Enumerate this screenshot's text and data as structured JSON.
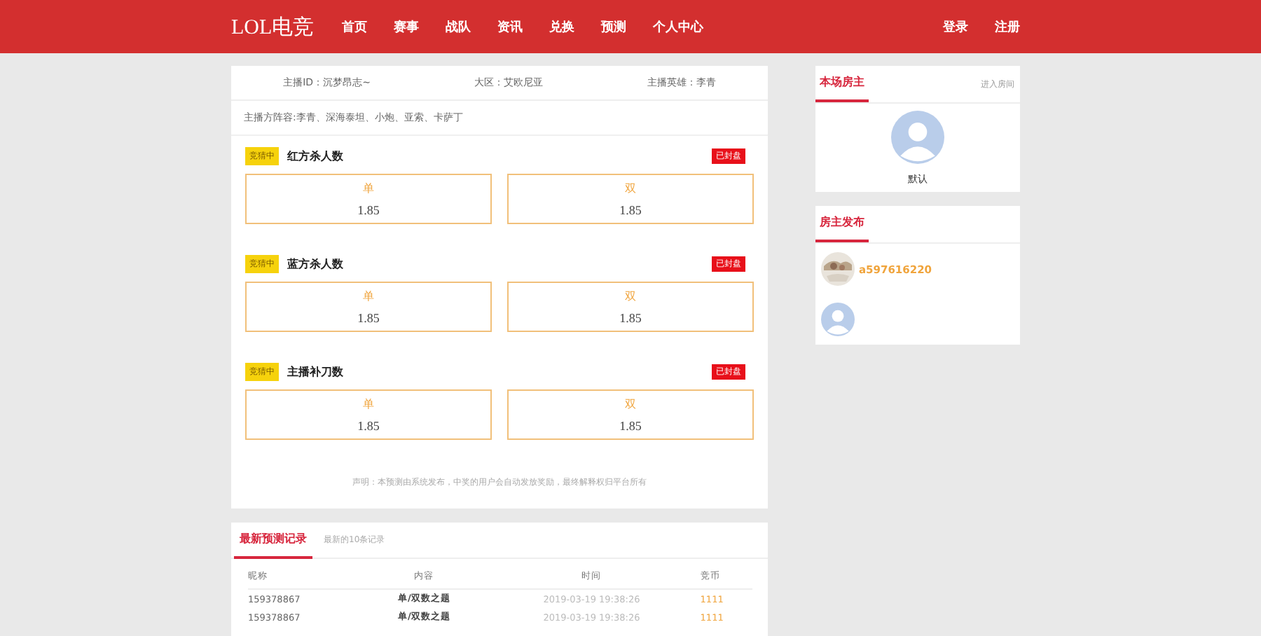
{
  "header": {
    "logo": "LOL电竞",
    "nav": [
      {
        "label": "首页",
        "selected": false
      },
      {
        "label": "赛事",
        "selected": false
      },
      {
        "label": "战队",
        "selected": false
      },
      {
        "label": "资讯",
        "selected": false
      },
      {
        "label": "兑换",
        "selected": false
      },
      {
        "label": "预测",
        "selected": false
      },
      {
        "label": "个人中心",
        "selected": false
      }
    ],
    "auth": [
      "登录",
      "注册"
    ]
  },
  "info": [
    "主播ID：沉梦昂志~",
    "大区：艾欧尼亚",
    "主播英雄：李青"
  ],
  "lineup": "主播方阵容:李青、深海泰坦、小炮、亚索、卡萨丁",
  "questions": [
    {
      "badge": "竞猜中",
      "title": "红方杀人数",
      "status": "已封盘",
      "options": [
        {
          "label": "单",
          "odds": "1.85"
        },
        {
          "label": "双",
          "odds": "1.85"
        }
      ]
    },
    {
      "badge": "竞猜中",
      "title": "蓝方杀人数",
      "status": "已封盘",
      "options": [
        {
          "label": "单",
          "odds": "1.85"
        },
        {
          "label": "双",
          "odds": "1.85"
        }
      ]
    },
    {
      "badge": "竞猜中",
      "title": "主播补刀数",
      "status": "已封盘",
      "options": [
        {
          "label": "单",
          "odds": "1.85"
        },
        {
          "label": "双",
          "odds": "1.85"
        }
      ]
    }
  ],
  "notice": "声明：本预测由系统发布，中奖的用户会自动发放奖励，最终解释权归平台所有",
  "records": {
    "tab": "最新预测记录",
    "subtitle": "最新的10条记录",
    "columns": [
      "昵称",
      "内容",
      "时间",
      "竞币"
    ],
    "rows": [
      [
        "159378867",
        "单/双数之题",
        "2019-03-19 19:38:26",
        "1111"
      ],
      [
        "159378867",
        "单/双数之题",
        "2019-03-19 19:38:26",
        "1111"
      ]
    ]
  },
  "host": {
    "tab": "本场房主",
    "link": "进入房间",
    "name": "默认"
  },
  "posts": {
    "tab": "房主发布",
    "items": [
      {
        "name": "a597616220"
      },
      {
        "kind": "default"
      }
    ]
  }
}
